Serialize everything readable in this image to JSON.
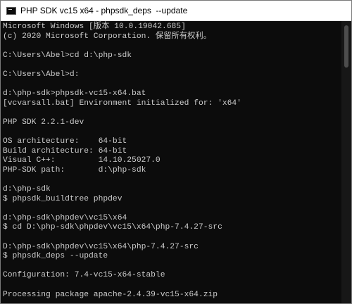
{
  "window": {
    "title": "PHP SDK vc15 x64 - phpsdk_deps  --update",
    "icon": "console-icon",
    "colors": {
      "console_bg": "#0c0c0c",
      "console_fg": "#cccccc",
      "titlebar_bg": "#ffffff"
    }
  },
  "console": {
    "lines": [
      "Microsoft Windows [版本 10.0.19042.685]",
      "(c) 2020 Microsoft Corporation. 保留所有权利。",
      "",
      "C:\\Users\\Abel>cd d:\\php-sdk",
      "",
      "C:\\Users\\Abel>d:",
      "",
      "d:\\php-sdk>phpsdk-vc15-x64.bat",
      "[vcvarsall.bat] Environment initialized for: 'x64'",
      "",
      "PHP SDK 2.2.1-dev",
      "",
      "OS architecture:    64-bit",
      "Build architecture: 64-bit",
      "Visual C++:         14.10.25027.0",
      "PHP-SDK path:       d:\\php-sdk",
      "",
      "d:\\php-sdk",
      "$ phpsdk_buildtree phpdev",
      "",
      "d:\\php-sdk\\phpdev\\vc15\\x64",
      "$ cd D:\\php-sdk\\phpdev\\vc15\\x64\\php-7.4.27-src",
      "",
      "D:\\php-sdk\\phpdev\\vc15\\x64\\php-7.4.27-src",
      "$ phpsdk_deps --update",
      "",
      "Configuration: 7.4-vc15-x64-stable",
      "",
      "Processing package apache-2.4.39-vc15-x64.zip"
    ]
  }
}
